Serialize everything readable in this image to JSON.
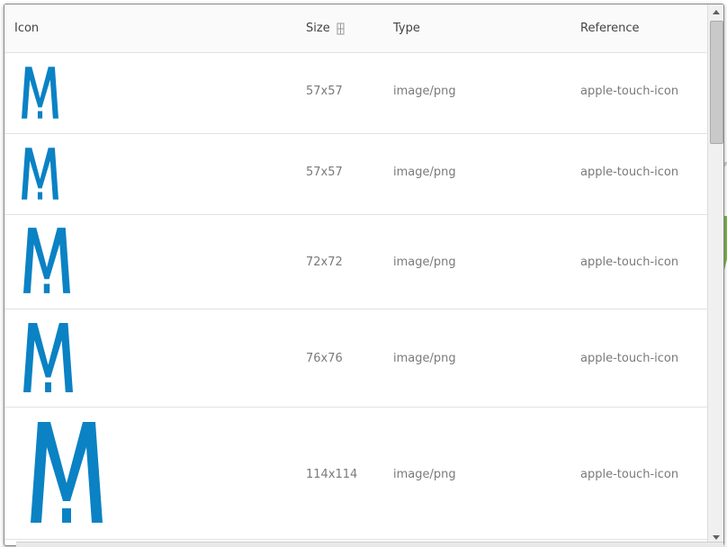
{
  "table": {
    "headers": {
      "icon": "Icon",
      "size": "Size",
      "type": "Type",
      "reference": "Reference"
    },
    "rows": [
      {
        "size": "57x57",
        "type": "image/png",
        "reference": "apple-touch-icon"
      },
      {
        "size": "57x57",
        "type": "image/png",
        "reference": "apple-touch-icon"
      },
      {
        "size": "72x72",
        "type": "image/png",
        "reference": "apple-touch-icon"
      },
      {
        "size": "76x76",
        "type": "image/png",
        "reference": "apple-touch-icon"
      },
      {
        "size": "114x114",
        "type": "image/png",
        "reference": "apple-touch-icon"
      }
    ]
  },
  "colors": {
    "logo": "#0a82c4",
    "background_accent": "#7ab648"
  },
  "icons": {
    "sort": "sort-icon",
    "scroll_up": "arrow-up-icon",
    "scroll_down": "arrow-down-icon",
    "row_icon": "app-logo-icon"
  }
}
